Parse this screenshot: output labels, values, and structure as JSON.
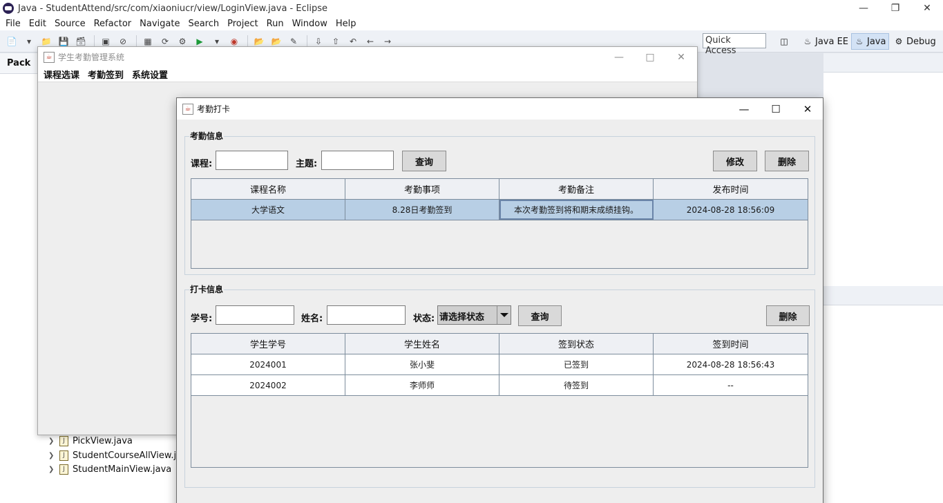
{
  "eclipse": {
    "title": "Java - StudentAttend/src/com/xiaoniucr/view/LoginView.java - Eclipse",
    "menu": [
      "File",
      "Edit",
      "Source",
      "Refactor",
      "Navigate",
      "Search",
      "Project",
      "Run",
      "Window",
      "Help"
    ],
    "quick_access": "Quick Access",
    "perspectives": [
      "Java EE",
      "Java",
      "Debug"
    ],
    "package_tab": "Pack",
    "tree_files": [
      "PickView.java",
      "StudentCourseAllView.java",
      "StudentMainView.java"
    ]
  },
  "main_window": {
    "title": "学生考勤管理系统",
    "menu": [
      "课程选课",
      "考勤签到",
      "系统设置"
    ]
  },
  "dialog": {
    "title": "考勤打卡",
    "attendance": {
      "group_title": "考勤信息",
      "course_label": "课程:",
      "topic_label": "主题:",
      "course_value": "",
      "topic_value": "",
      "query_btn": "查询",
      "edit_btn": "修改",
      "delete_btn": "删除",
      "columns": [
        "课程名称",
        "考勤事项",
        "考勤备注",
        "发布时间"
      ],
      "rows": [
        [
          "大学语文",
          "8.28日考勤签到",
          "本次考勤签到将和期末成绩挂钩。",
          "2024-08-28 18:56:09"
        ]
      ]
    },
    "checkin": {
      "group_title": "打卡信息",
      "student_no_label": "学号:",
      "name_label": "姓名:",
      "status_label": "状态:",
      "student_no_value": "",
      "name_value": "",
      "status_selected": "请选择状态",
      "query_btn": "查询",
      "delete_btn": "删除",
      "columns": [
        "学生学号",
        "学生姓名",
        "签到状态",
        "签到时间"
      ],
      "rows": [
        [
          "2024001",
          "张小斐",
          "已签到",
          "2024-08-28 18:56:43"
        ],
        [
          "2024002",
          "李师师",
          "待签到",
          "--"
        ]
      ]
    }
  }
}
